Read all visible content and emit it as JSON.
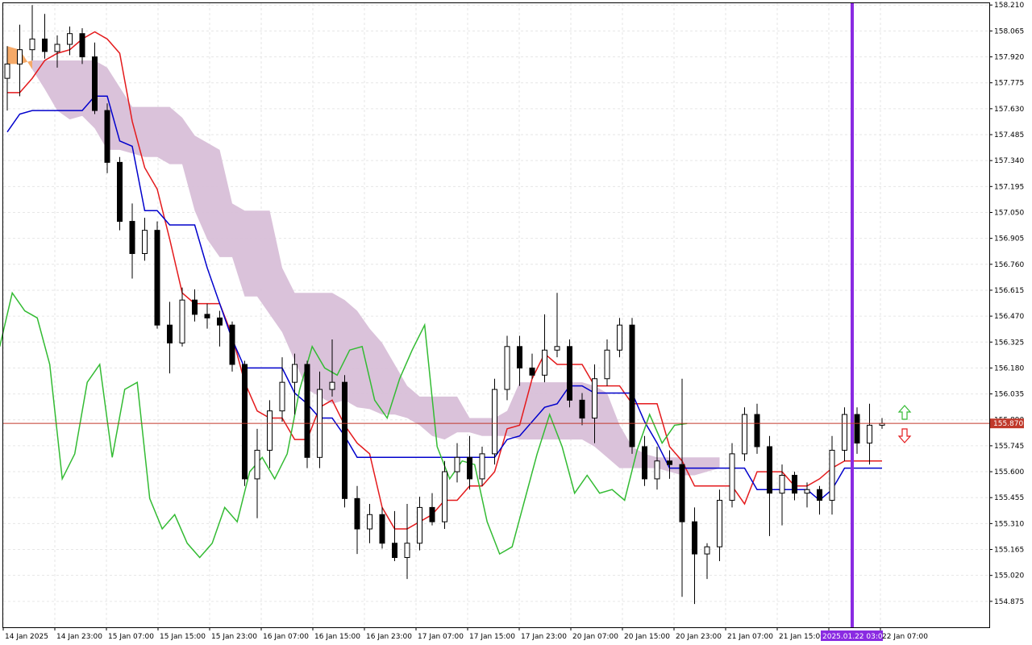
{
  "chart_data": {
    "type": "candlestick",
    "indicator": "Ichimoku Kinko Hyo",
    "y_axis": {
      "position": "right",
      "ylim": [
        154.73,
        158.22
      ],
      "ticks": [
        "158.210",
        "158.065",
        "157.920",
        "157.775",
        "157.630",
        "157.485",
        "157.340",
        "157.195",
        "157.050",
        "156.905",
        "156.760",
        "156.615",
        "156.470",
        "156.325",
        "156.180",
        "156.035",
        "155.890",
        "155.745",
        "155.600",
        "155.455",
        "155.310",
        "155.165",
        "155.020",
        "154.875"
      ]
    },
    "x_axis": {
      "labels": [
        "14 Jan 2025",
        "14 Jan 23:00",
        "15 Jan 07:00",
        "15 Jan 15:00",
        "15 Jan 23:00",
        "16 Jan 07:00",
        "16 Jan 15:00",
        "16 Jan 23:00",
        "17 Jan 07:00",
        "17 Jan 15:00",
        "17 Jan 23:00",
        "20 Jan 07:00",
        "20 Jan 15:00",
        "20 Jan 23:00",
        "21 Jan 07:00",
        "21 Jan 15:00",
        "2025.01.22 03:00",
        "22 Jan 07:00"
      ],
      "highlight_label": "2025.01.22 03:00"
    },
    "current_price": {
      "value": 155.87,
      "label": "155.870",
      "color": "#c0392b"
    },
    "colors": {
      "background": "#ffffff",
      "grid": "#e6e6e6",
      "bull_body": "#ffffff",
      "bear_body": "#000000",
      "wick": "#000000",
      "tenkan": "#e41a1c",
      "kijun": "#0000cc",
      "chikou": "#33bb33",
      "kumo_bear": "#d8bfd8",
      "kumo_bull": "#f4a460",
      "vertical_line": "#8a2be2",
      "arrow_up": "#33bb33",
      "arrow_down": "#e41a1c"
    },
    "candles": [
      {
        "o": 157.8,
        "h": 157.98,
        "l": 157.62,
        "c": 157.88
      },
      {
        "o": 157.88,
        "h": 158.1,
        "l": 157.7,
        "c": 157.96
      },
      {
        "o": 157.96,
        "h": 158.21,
        "l": 157.9,
        "c": 158.02
      },
      {
        "o": 158.02,
        "h": 158.16,
        "l": 157.91,
        "c": 157.95
      },
      {
        "o": 157.95,
        "h": 158.04,
        "l": 157.86,
        "c": 157.99
      },
      {
        "o": 157.99,
        "h": 158.09,
        "l": 157.93,
        "c": 158.05
      },
      {
        "o": 158.05,
        "h": 158.08,
        "l": 157.88,
        "c": 157.92
      },
      {
        "o": 157.92,
        "h": 158.0,
        "l": 157.6,
        "c": 157.62
      },
      {
        "o": 157.62,
        "h": 157.66,
        "l": 157.27,
        "c": 157.33
      },
      {
        "o": 157.33,
        "h": 157.36,
        "l": 156.95,
        "c": 157.0
      },
      {
        "o": 157.0,
        "h": 157.1,
        "l": 156.68,
        "c": 156.82
      },
      {
        "o": 156.82,
        "h": 157.02,
        "l": 156.78,
        "c": 156.95
      },
      {
        "o": 156.95,
        "h": 157.0,
        "l": 156.4,
        "c": 156.42
      },
      {
        "o": 156.42,
        "h": 156.55,
        "l": 156.15,
        "c": 156.32
      },
      {
        "o": 156.32,
        "h": 156.63,
        "l": 156.3,
        "c": 156.56
      },
      {
        "o": 156.56,
        "h": 156.62,
        "l": 156.44,
        "c": 156.48
      },
      {
        "o": 156.48,
        "h": 156.54,
        "l": 156.4,
        "c": 156.46
      },
      {
        "o": 156.46,
        "h": 156.5,
        "l": 156.3,
        "c": 156.42
      },
      {
        "o": 156.42,
        "h": 156.44,
        "l": 156.16,
        "c": 156.2
      },
      {
        "o": 156.2,
        "h": 156.22,
        "l": 155.52,
        "c": 155.56
      },
      {
        "o": 155.56,
        "h": 155.84,
        "l": 155.34,
        "c": 155.72
      },
      {
        "o": 155.72,
        "h": 156.0,
        "l": 155.62,
        "c": 155.94
      },
      {
        "o": 155.94,
        "h": 156.24,
        "l": 155.88,
        "c": 156.1
      },
      {
        "o": 156.1,
        "h": 156.26,
        "l": 155.92,
        "c": 156.2
      },
      {
        "o": 156.2,
        "h": 156.22,
        "l": 155.62,
        "c": 155.68
      },
      {
        "o": 155.68,
        "h": 156.16,
        "l": 155.62,
        "c": 156.06
      },
      {
        "o": 156.06,
        "h": 156.34,
        "l": 156.02,
        "c": 156.1
      },
      {
        "o": 156.1,
        "h": 156.14,
        "l": 155.4,
        "c": 155.45
      },
      {
        "o": 155.45,
        "h": 155.52,
        "l": 155.14,
        "c": 155.28
      },
      {
        "o": 155.28,
        "h": 155.42,
        "l": 155.2,
        "c": 155.36
      },
      {
        "o": 155.36,
        "h": 155.4,
        "l": 155.17,
        "c": 155.2
      },
      {
        "o": 155.2,
        "h": 155.38,
        "l": 155.1,
        "c": 155.12
      },
      {
        "o": 155.12,
        "h": 155.42,
        "l": 155.0,
        "c": 155.2
      },
      {
        "o": 155.2,
        "h": 155.46,
        "l": 155.16,
        "c": 155.4
      },
      {
        "o": 155.4,
        "h": 155.48,
        "l": 155.3,
        "c": 155.32
      },
      {
        "o": 155.32,
        "h": 155.66,
        "l": 155.28,
        "c": 155.6
      },
      {
        "o": 155.6,
        "h": 155.76,
        "l": 155.54,
        "c": 155.68
      },
      {
        "o": 155.68,
        "h": 155.8,
        "l": 155.5,
        "c": 155.56
      },
      {
        "o": 155.56,
        "h": 155.74,
        "l": 155.52,
        "c": 155.7
      },
      {
        "o": 155.7,
        "h": 156.12,
        "l": 155.64,
        "c": 156.06
      },
      {
        "o": 156.06,
        "h": 156.36,
        "l": 156.0,
        "c": 156.3
      },
      {
        "o": 156.3,
        "h": 156.36,
        "l": 156.08,
        "c": 156.18
      },
      {
        "o": 156.18,
        "h": 156.26,
        "l": 156.12,
        "c": 156.14
      },
      {
        "o": 156.14,
        "h": 156.48,
        "l": 156.1,
        "c": 156.28
      },
      {
        "o": 156.28,
        "h": 156.6,
        "l": 156.24,
        "c": 156.3
      },
      {
        "o": 156.3,
        "h": 156.34,
        "l": 155.96,
        "c": 156.0
      },
      {
        "o": 156.0,
        "h": 156.04,
        "l": 155.86,
        "c": 155.9
      },
      {
        "o": 155.9,
        "h": 156.2,
        "l": 155.76,
        "c": 156.12
      },
      {
        "o": 156.12,
        "h": 156.34,
        "l": 156.08,
        "c": 156.28
      },
      {
        "o": 156.28,
        "h": 156.46,
        "l": 156.24,
        "c": 156.42
      },
      {
        "o": 156.42,
        "h": 156.46,
        "l": 155.7,
        "c": 155.74
      },
      {
        "o": 155.74,
        "h": 155.8,
        "l": 155.52,
        "c": 155.56
      },
      {
        "o": 155.56,
        "h": 155.74,
        "l": 155.5,
        "c": 155.66
      },
      {
        "o": 155.66,
        "h": 155.72,
        "l": 155.56,
        "c": 155.64
      },
      {
        "o": 155.64,
        "h": 156.12,
        "l": 154.9,
        "c": 155.32
      },
      {
        "o": 155.32,
        "h": 155.4,
        "l": 154.86,
        "c": 155.14
      },
      {
        "o": 155.14,
        "h": 155.2,
        "l": 155.0,
        "c": 155.18
      },
      {
        "o": 155.18,
        "h": 155.5,
        "l": 155.1,
        "c": 155.44
      },
      {
        "o": 155.44,
        "h": 155.76,
        "l": 155.4,
        "c": 155.7
      },
      {
        "o": 155.7,
        "h": 155.96,
        "l": 155.66,
        "c": 155.92
      },
      {
        "o": 155.92,
        "h": 155.98,
        "l": 155.7,
        "c": 155.74
      },
      {
        "o": 155.74,
        "h": 155.8,
        "l": 155.24,
        "c": 155.48
      },
      {
        "o": 155.48,
        "h": 155.64,
        "l": 155.3,
        "c": 155.58
      },
      {
        "o": 155.58,
        "h": 155.6,
        "l": 155.44,
        "c": 155.48
      },
      {
        "o": 155.48,
        "h": 155.54,
        "l": 155.4,
        "c": 155.5
      },
      {
        "o": 155.5,
        "h": 155.52,
        "l": 155.36,
        "c": 155.44
      },
      {
        "o": 155.44,
        "h": 155.8,
        "l": 155.36,
        "c": 155.72
      },
      {
        "o": 155.72,
        "h": 155.96,
        "l": 155.66,
        "c": 155.92
      },
      {
        "o": 155.92,
        "h": 155.96,
        "l": 155.7,
        "c": 155.76
      },
      {
        "o": 155.76,
        "h": 155.98,
        "l": 155.64,
        "c": 155.86
      },
      {
        "o": 155.86,
        "h": 155.9,
        "l": 155.84,
        "c": 155.87
      }
    ],
    "series": [
      {
        "name": "",
        "kind": "tenkan",
        "values": [
          157.72,
          157.72,
          157.8,
          157.9,
          157.94,
          157.96,
          158.02,
          158.06,
          158.02,
          157.94,
          157.56,
          157.3,
          157.18,
          156.9,
          156.6,
          156.54,
          156.54,
          156.54,
          156.36,
          156.1,
          155.94,
          155.9,
          155.9,
          155.78,
          155.78,
          155.96,
          156.0,
          155.86,
          155.76,
          155.7,
          155.4,
          155.28,
          155.28,
          155.32,
          155.36,
          155.44,
          155.44,
          155.52,
          155.52,
          155.6,
          155.84,
          155.86,
          156.12,
          156.26,
          156.2,
          156.2,
          156.2,
          156.08,
          156.08,
          156.08,
          155.98,
          155.98,
          155.98,
          155.74,
          155.66,
          155.52,
          155.52,
          155.52,
          155.52,
          155.42,
          155.6,
          155.6,
          155.6,
          155.52,
          155.52,
          155.56,
          155.62,
          155.66,
          155.66,
          155.66,
          155.66
        ]
      },
      {
        "name": "",
        "kind": "kijun",
        "values": [
          157.5,
          157.6,
          157.62,
          157.62,
          157.62,
          157.62,
          157.62,
          157.7,
          157.7,
          157.45,
          157.42,
          157.06,
          157.06,
          156.98,
          156.98,
          156.98,
          156.74,
          156.54,
          156.34,
          156.18,
          156.18,
          156.18,
          156.18,
          156.04,
          155.98,
          155.9,
          155.9,
          155.8,
          155.68,
          155.68,
          155.68,
          155.68,
          155.68,
          155.68,
          155.68,
          155.68,
          155.68,
          155.68,
          155.68,
          155.68,
          155.78,
          155.8,
          155.88,
          155.96,
          155.98,
          156.08,
          156.08,
          156.04,
          156.04,
          156.04,
          156.04,
          155.88,
          155.76,
          155.62,
          155.62,
          155.62,
          155.62,
          155.62,
          155.62,
          155.62,
          155.5,
          155.5,
          155.5,
          155.5,
          155.5,
          155.44,
          155.5,
          155.62,
          155.62,
          155.62,
          155.62
        ]
      },
      {
        "name": "",
        "kind": "chikou",
        "values": [
          156.3,
          156.6,
          156.5,
          156.46,
          156.2,
          155.56,
          155.7,
          156.1,
          156.2,
          155.68,
          156.06,
          156.1,
          155.45,
          155.28,
          155.36,
          155.2,
          155.12,
          155.2,
          155.4,
          155.32,
          155.6,
          155.68,
          155.56,
          155.7,
          156.06,
          156.3,
          156.18,
          156.14,
          156.28,
          156.3,
          156.0,
          155.9,
          156.12,
          156.28,
          156.42,
          155.74,
          155.56,
          155.66,
          155.64,
          155.32,
          155.14,
          155.18,
          155.44,
          155.7,
          155.92,
          155.74,
          155.48,
          155.58,
          155.48,
          155.5,
          155.44,
          155.72,
          155.92,
          155.76,
          155.86,
          155.87
        ]
      }
    ],
    "cloud": {
      "span_a": [
        157.98,
        157.96,
        157.85,
        157.74,
        157.62,
        157.57,
        157.59,
        157.52,
        157.4,
        157.4,
        157.38,
        157.36,
        157.36,
        157.32,
        157.32,
        157.06,
        156.9,
        156.8,
        156.8,
        156.58,
        156.58,
        156.48,
        156.38,
        156.22,
        156.06,
        156.02,
        155.98,
        156.0,
        155.96,
        155.95,
        155.92,
        155.92,
        155.9,
        155.86,
        155.8,
        155.78,
        155.82,
        155.82,
        155.8,
        155.8,
        155.8,
        155.78,
        155.78,
        155.78,
        155.78,
        155.78,
        155.78,
        155.74,
        155.68,
        155.62,
        155.62,
        155.62,
        155.62,
        155.6,
        155.58,
        155.58,
        155.6,
        155.62
      ],
      "span_b": [
        157.88,
        157.88,
        157.9,
        157.9,
        157.9,
        157.9,
        157.9,
        157.9,
        157.86,
        157.75,
        157.64,
        157.64,
        157.64,
        157.64,
        157.58,
        157.48,
        157.44,
        157.4,
        157.1,
        157.06,
        157.06,
        157.06,
        156.74,
        156.6,
        156.6,
        156.6,
        156.6,
        156.56,
        156.5,
        156.4,
        156.32,
        156.2,
        156.08,
        156.02,
        156.02,
        156.02,
        156.02,
        155.9,
        155.9,
        155.9,
        155.94,
        156.1,
        156.1,
        156.1,
        156.1,
        156.1,
        156.1,
        156.08,
        156.04,
        155.86,
        155.74,
        155.7,
        155.68,
        155.68,
        155.68,
        155.68,
        155.68,
        155.68
      ]
    },
    "markers": [
      {
        "kind": "buy",
        "icon": "arrow-up-icon"
      },
      {
        "kind": "sell",
        "icon": "arrow-down-icon"
      }
    ],
    "grid": true
  }
}
